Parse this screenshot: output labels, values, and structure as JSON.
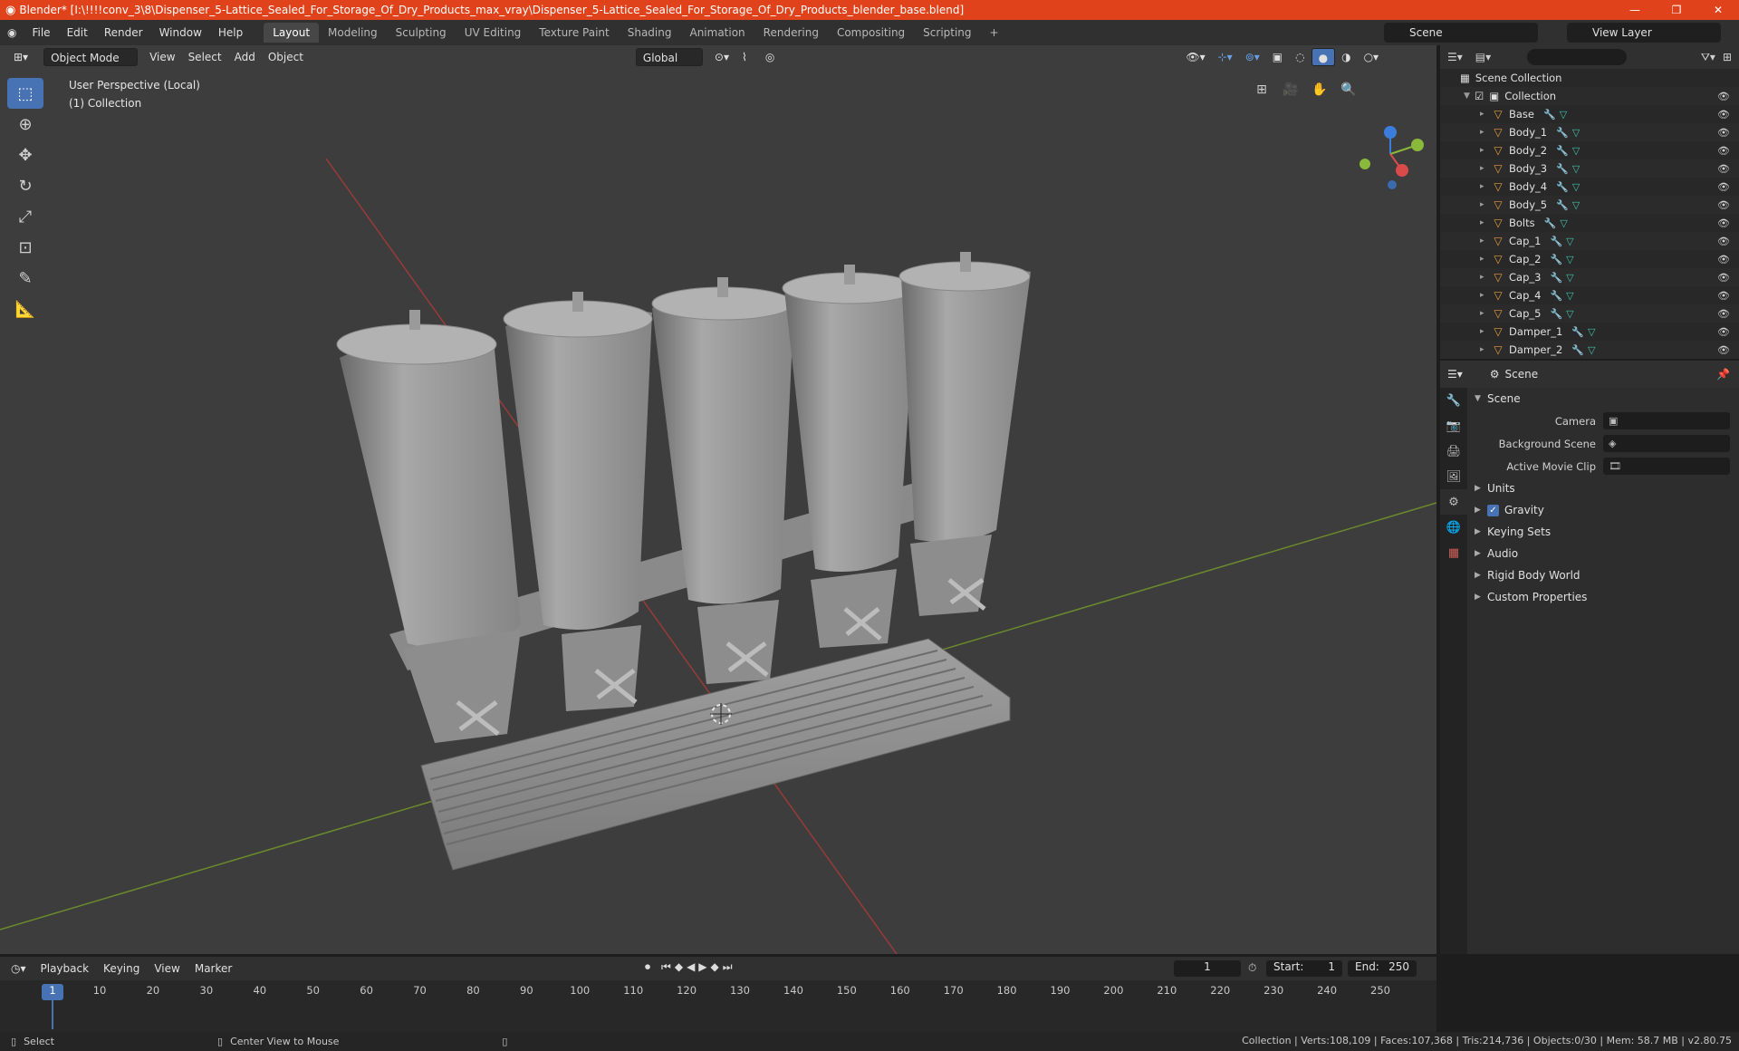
{
  "titlebar": {
    "title": "Blender* [I:\\!!!!conv_3\\8\\Dispenser_5-Lattice_Sealed_For_Storage_Of_Dry_Products_max_vray\\Dispenser_5-Lattice_Sealed_For_Storage_Of_Dry_Products_blender_base.blend]"
  },
  "menu": {
    "items": [
      "File",
      "Edit",
      "Render",
      "Window",
      "Help"
    ]
  },
  "workspaces": [
    "Layout",
    "Modeling",
    "Sculpting",
    "UV Editing",
    "Texture Paint",
    "Shading",
    "Animation",
    "Rendering",
    "Compositing",
    "Scripting"
  ],
  "scene_selector": "Scene",
  "view_layer_selector": "View Layer",
  "viewport": {
    "mode": "Object Mode",
    "menus": [
      "View",
      "Select",
      "Add",
      "Object"
    ],
    "transform_orientation": "Global",
    "info_line1": "User Perspective (Local)",
    "info_line2": "(1) Collection"
  },
  "outliner": {
    "root": "Scene Collection",
    "collection": "Collection",
    "objects": [
      "Base",
      "Body_1",
      "Body_2",
      "Body_3",
      "Body_4",
      "Body_5",
      "Bolts",
      "Cap_1",
      "Cap_2",
      "Cap_3",
      "Cap_4",
      "Cap_5",
      "Damper_1",
      "Damper_2"
    ]
  },
  "properties": {
    "header": "Scene",
    "section": "Scene",
    "camera_label": "Camera",
    "background_scene_label": "Background Scene",
    "active_movie_clip_label": "Active Movie Clip",
    "panels": [
      "Units",
      "Gravity",
      "Keying Sets",
      "Audio",
      "Rigid Body World",
      "Custom Properties"
    ]
  },
  "timeline": {
    "menus": [
      "Playback",
      "Keying",
      "View",
      "Marker"
    ],
    "current_frame": "1",
    "start_label": "Start:",
    "start_value": "1",
    "end_label": "End:",
    "end_value": "250",
    "ticks": [
      "1",
      "10",
      "20",
      "30",
      "40",
      "50",
      "60",
      "70",
      "80",
      "90",
      "100",
      "110",
      "120",
      "130",
      "140",
      "150",
      "160",
      "170",
      "180",
      "190",
      "200",
      "210",
      "220",
      "230",
      "240",
      "250"
    ]
  },
  "statusbar": {
    "left": "Select",
    "middle": "Center View to Mouse",
    "right": "Collection | Verts:108,109 | Faces:107,368 | Tris:214,736 | Objects:0/30 | Mem: 58.7 MB | v2.80.75"
  },
  "colors": {
    "title_bg": "#e0431b",
    "accent": "#4772b3",
    "viewport_bg": "#3d3d3d",
    "object_icon": "#e99b3c"
  }
}
